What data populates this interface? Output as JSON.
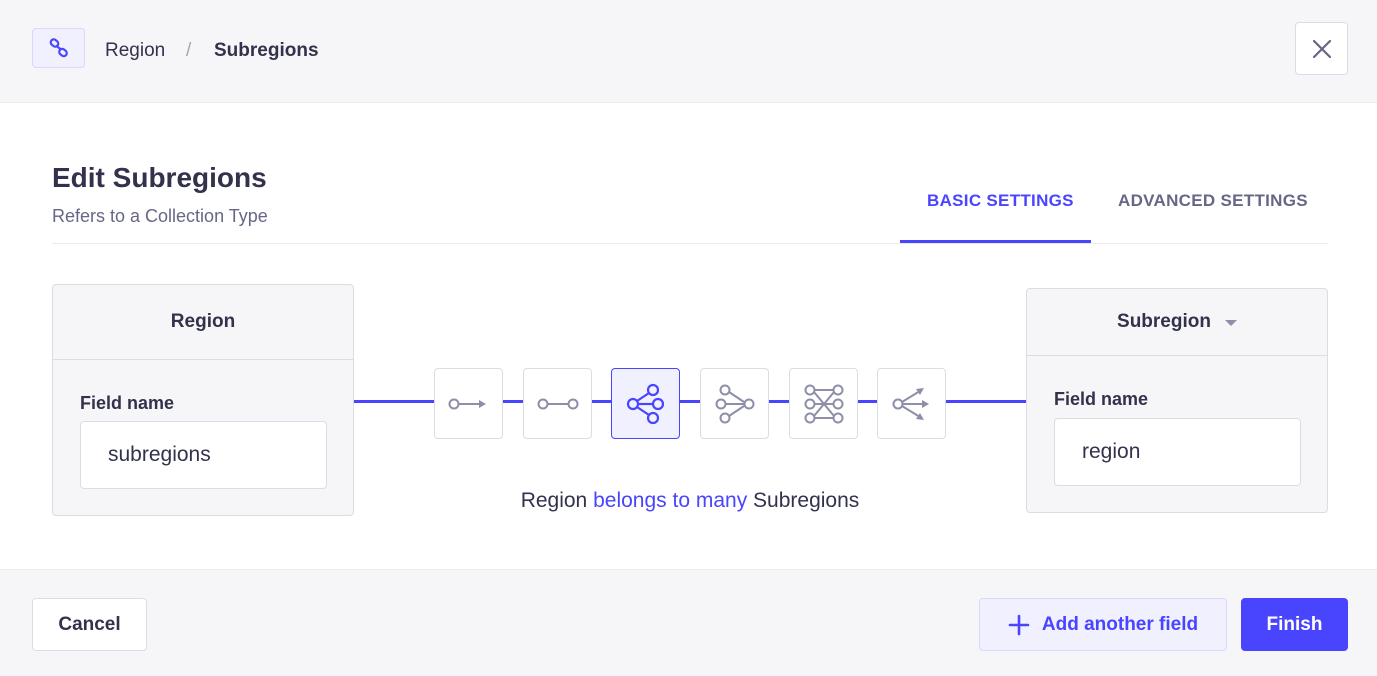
{
  "header": {
    "icon": "link-icon",
    "breadcrumb": {
      "parent": "Region",
      "separator": "/",
      "current": "Subregions"
    },
    "close_icon": "close-icon"
  },
  "main": {
    "title": "Edit Subregions",
    "subtitle": "Refers to a Collection Type",
    "tabs": [
      {
        "label": "BASIC SETTINGS",
        "active": true
      },
      {
        "label": "ADVANCED SETTINGS",
        "active": false
      }
    ]
  },
  "left_card": {
    "title": "Region",
    "field_label": "Field name",
    "field_value": "subregions"
  },
  "right_card": {
    "title": "Subregion",
    "field_label": "Field name",
    "field_value": "region"
  },
  "relations": [
    {
      "icon": "one-way-relation-icon",
      "active": false
    },
    {
      "icon": "one-to-one-relation-icon",
      "active": false
    },
    {
      "icon": "one-to-many-relation-icon",
      "active": true
    },
    {
      "icon": "many-to-one-relation-icon",
      "active": false
    },
    {
      "icon": "many-to-many-relation-icon",
      "active": false
    },
    {
      "icon": "many-way-relation-icon",
      "active": false
    }
  ],
  "relation_text": {
    "source": "Region",
    "verb": "belongs to many",
    "target": "Subregions"
  },
  "footer": {
    "cancel_label": "Cancel",
    "add_label": "Add another field",
    "finish_label": "Finish"
  },
  "colors": {
    "accent": "#4945ff",
    "accent_light": "#f0f0ff",
    "border": "#dcdce4",
    "muted": "#666687",
    "text": "#32324d"
  }
}
